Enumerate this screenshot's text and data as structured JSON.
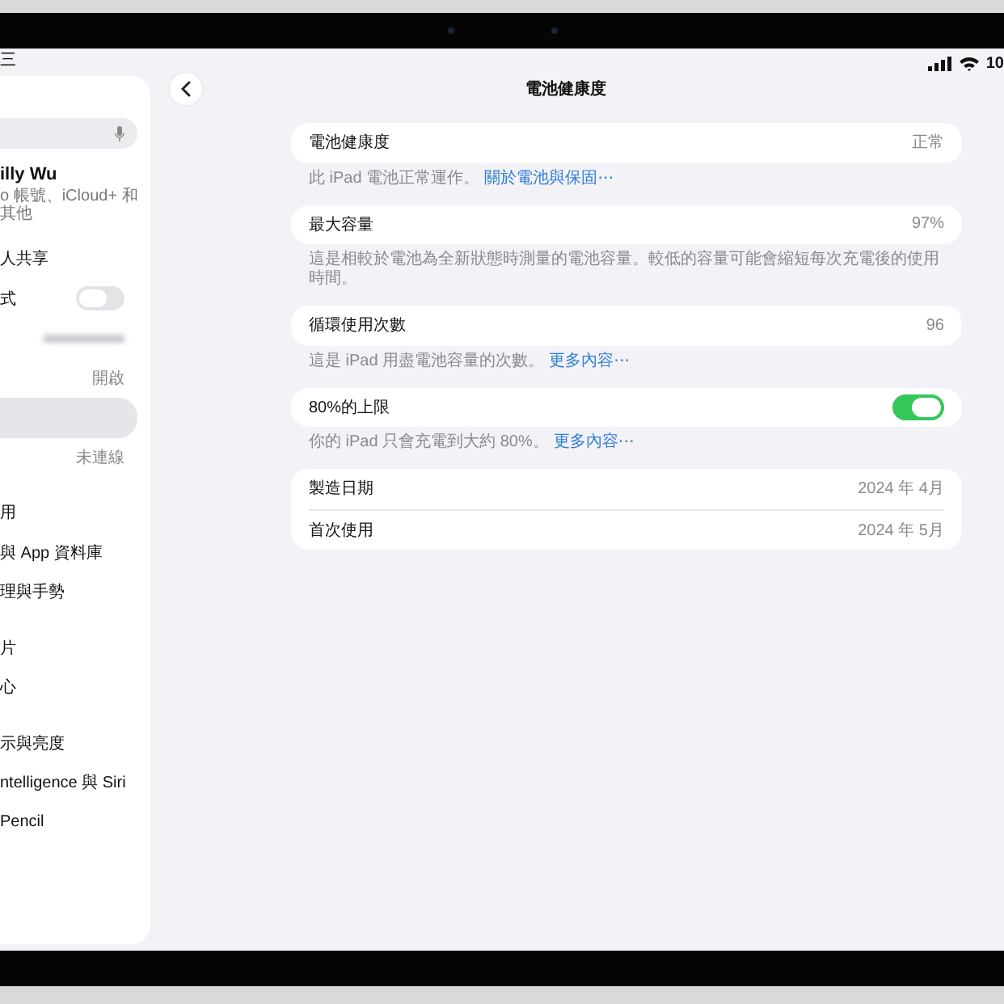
{
  "status_bar": {
    "time": "三",
    "battery": "10"
  },
  "sidebar": {
    "profile": {
      "name": "illy Wu",
      "subtitle": "o 帳號、iCloud+ 和其他"
    },
    "groups": [
      {
        "items": [
          {
            "kind": "label",
            "label": "人共享",
            "selected": false
          },
          {
            "kind": "toggle",
            "label": "式",
            "on": false,
            "selected": false
          },
          {
            "kind": "redacted",
            "selected": false
          },
          {
            "kind": "value",
            "value": "開啟",
            "selected": false
          },
          {
            "kind": "blank",
            "selected": true
          },
          {
            "kind": "value",
            "value": "未連線",
            "selected": false
          }
        ]
      },
      {
        "items": [
          {
            "kind": "label",
            "label": "用",
            "selected": false
          },
          {
            "kind": "label",
            "label": "與 App 資料庫",
            "selected": false
          },
          {
            "kind": "label",
            "label": "理與手勢",
            "selected": false
          }
        ]
      },
      {
        "items": [
          {
            "kind": "label",
            "label": "片",
            "selected": false
          },
          {
            "kind": "label",
            "label": "心",
            "selected": false
          }
        ]
      },
      {
        "items": [
          {
            "kind": "label",
            "label": "示與亮度",
            "selected": false
          },
          {
            "kind": "label",
            "label": "ntelligence 與 Siri",
            "selected": false
          },
          {
            "kind": "label",
            "label": "Pencil",
            "selected": false
          }
        ]
      }
    ]
  },
  "page": {
    "title": "電池健康度",
    "sections": [
      {
        "rows": [
          {
            "kind": "value",
            "label": "電池健康度",
            "value": "正常"
          }
        ],
        "footer": {
          "text": "此 iPad 電池正常運作。",
          "link": "關於電池與保固⋯"
        }
      },
      {
        "rows": [
          {
            "kind": "value",
            "label": "最大容量",
            "value": "97%"
          }
        ],
        "footer": {
          "text": "這是相較於電池為全新狀態時測量的電池容量。較低的容量可能會縮短每次充電後的使用時間。"
        }
      },
      {
        "rows": [
          {
            "kind": "value",
            "label": "循環使用次數",
            "value": "96"
          }
        ],
        "footer": {
          "text": "這是 iPad 用盡電池容量的次數。",
          "link": "更多內容⋯"
        }
      },
      {
        "rows": [
          {
            "kind": "toggle",
            "label": "80%的上限",
            "on": true
          }
        ],
        "footer": {
          "text": "你的 iPad 只會充電到大約 80%。",
          "link": "更多內容⋯"
        }
      },
      {
        "rows": [
          {
            "kind": "value",
            "label": "製造日期",
            "value": "2024 年 4月"
          },
          {
            "kind": "value",
            "label": "首次使用",
            "value": "2024 年 5月"
          }
        ]
      }
    ]
  }
}
